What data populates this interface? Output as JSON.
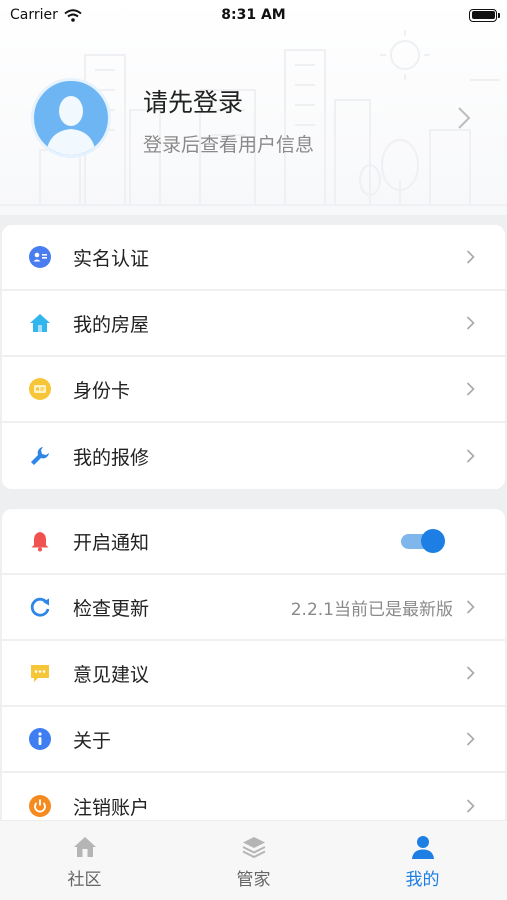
{
  "status_bar": {
    "carrier": "Carrier",
    "time": "8:31 AM"
  },
  "profile": {
    "title": "请先登录",
    "subtitle": "登录后查看用户信息"
  },
  "menu_group_1": [
    {
      "label": "实名认证",
      "icon": "id-card-icon",
      "color": "#4a7df0"
    },
    {
      "label": "我的房屋",
      "icon": "house-icon",
      "color": "#33b6ee"
    },
    {
      "label": "身份卡",
      "icon": "badge-icon",
      "color": "#f6c638"
    },
    {
      "label": "我的报修",
      "icon": "wrench-icon",
      "color": "#2e86e6"
    }
  ],
  "menu_group_2": {
    "notify": {
      "label": "开启通知",
      "enabled": true
    },
    "update": {
      "label": "检查更新",
      "value": "2.2.1当前已是最新版"
    },
    "feedback": {
      "label": "意见建议"
    },
    "about": {
      "label": "关于"
    },
    "logout": {
      "label": "注销账户"
    }
  },
  "tabs": [
    {
      "label": "社区",
      "icon": "home-icon",
      "active": false
    },
    {
      "label": "管家",
      "icon": "layers-icon",
      "active": false
    },
    {
      "label": "我的",
      "icon": "person-icon",
      "active": true
    }
  ],
  "colors": {
    "accent": "#1d7fe3",
    "background": "#eeeff1"
  }
}
